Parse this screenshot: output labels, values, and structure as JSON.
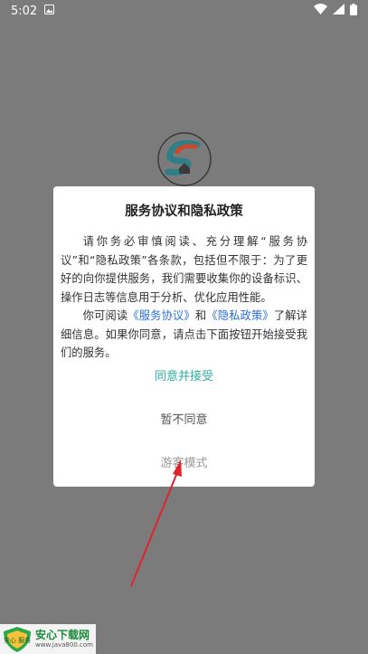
{
  "status_bar": {
    "time": "5:02",
    "notification_icon": "gallery-notification-icon",
    "icons": [
      "wifi-icon",
      "signal-icon",
      "battery-icon"
    ]
  },
  "dialog": {
    "title": "服务协议和隐私政策",
    "para1": "请你务必审慎阅读、充分理解“服务协议”和“隐私政策”各条款，包括但不限于：为了更好的向你提供服务，我们需要收集你的设备标识、操作日志等信息用于分析、优化应用性能。",
    "para2_prefix": "你可阅读",
    "link_service": "《服务协议》",
    "para2_and": "和",
    "link_privacy": "《隐私政策》",
    "para2_suffix": "了解详细信息。如果你同意，请点击下面按钮开始接受我们的服务。",
    "accept_label": "同意并接受",
    "decline_label": "暂不同意",
    "guest_label": "游客模式"
  },
  "watermark": {
    "name": "安心下载网",
    "url": "www.java800.com",
    "badge": "安心 服务"
  },
  "colors": {
    "overlay": "#7b7b7b",
    "accept": "#2bb0a0",
    "link": "#2b6ed9",
    "arrow": "#e0242f",
    "watermark_green": "#1a8b3b"
  }
}
